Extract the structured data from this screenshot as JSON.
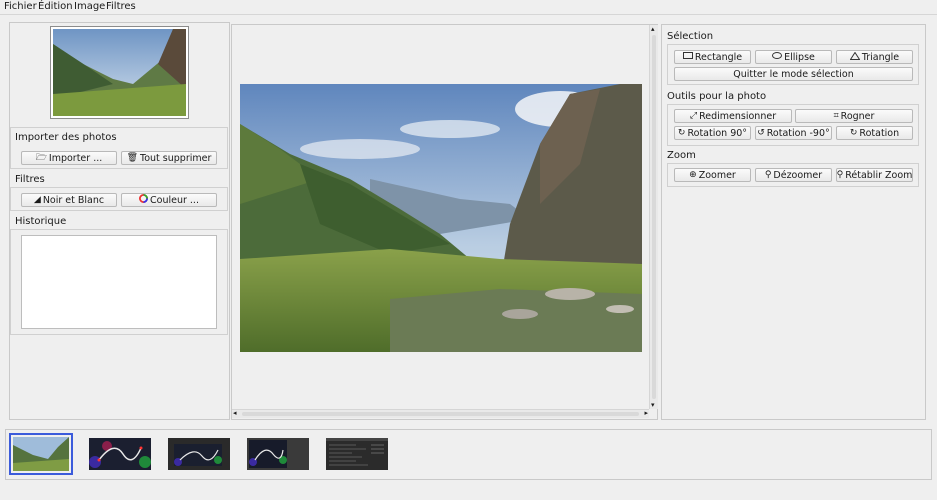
{
  "menu": [
    "Fichier",
    "Édition",
    "Image",
    "Filtres"
  ],
  "left": {
    "import_title": "Importer des photos",
    "import_btn": "Importer ...",
    "delete_all_btn": "Tout supprimer",
    "filters_title": "Filtres",
    "bw_btn": "Noir et Blanc",
    "color_btn": "Couleur ...",
    "history_title": "Historique"
  },
  "right": {
    "selection_title": "Sélection",
    "rectangle_btn": "Rectangle",
    "ellipse_btn": "Ellipse",
    "triangle_btn": "Triangle",
    "quit_selection_btn": "Quitter le mode sélection",
    "tools_title": "Outils pour la photo",
    "resize_btn": "Redimensionner",
    "crop_btn": "Rogner",
    "rot90_btn": "Rotation 90°",
    "rotm90_btn": "Rotation -90°",
    "rotation_btn": "Rotation",
    "zoom_title": "Zoom",
    "zoom_in_btn": "Zoomer",
    "zoom_out_btn": "Dézoomer",
    "zoom_reset_btn": "Rétablir Zoom"
  },
  "icons": {
    "folder": "folder-open-icon",
    "trash": "trash-icon",
    "bw": "black-white-filter-icon",
    "color": "color-wheel-icon",
    "rect": "rectangle-icon",
    "ellipse": "ellipse-icon",
    "triangle": "triangle-icon",
    "resize": "resize-icon",
    "crop": "crop-icon",
    "rotate": "rotate-icon",
    "zoom": "magnifier-icon"
  },
  "colors": {
    "selection_border": "#3b5bdb",
    "sky": "#8fb2d8",
    "mountain": "#4f6f3c"
  }
}
